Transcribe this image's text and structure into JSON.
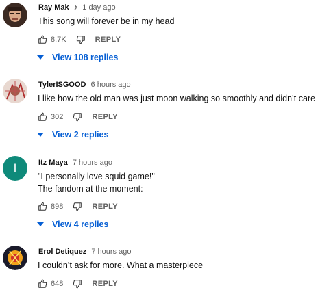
{
  "comments": [
    {
      "author": "Ray Mak",
      "note_icon": "music-note-icon",
      "time": "1 day ago",
      "lines": [
        "This song will forever be in my head"
      ],
      "likes": "8.7K",
      "reply_label": "REPLY",
      "view_replies": "View 108 replies",
      "avatar_color": "#6b4a3a"
    },
    {
      "author": "TylerISGOOD",
      "time": "6 hours ago",
      "lines": [
        "I like how the old man was just moon walking so smoothly and didn’t care"
      ],
      "likes": "302",
      "reply_label": "REPLY",
      "view_replies": "View 2 replies",
      "avatar_color": "#c87a7a"
    },
    {
      "author": "Itz Maya",
      "time": "7 hours ago",
      "avatar_letter": "I",
      "lines": [
        "\"I personally love squid game!\"",
        "The fandom at the moment:"
      ],
      "likes": "898",
      "reply_label": "REPLY",
      "view_replies": "View 4 replies",
      "avatar_color": "#0f8a7a"
    },
    {
      "author": "Erol Detiquez",
      "time": "7 hours ago",
      "lines": [
        "I couldn’t ask for more. What a masterpiece"
      ],
      "likes": "648",
      "reply_label": "REPLY",
      "avatar_color": "#f2a21b"
    }
  ],
  "colors": {
    "link": "#065fd4",
    "secondary": "#606060",
    "text": "#0f0f0f"
  }
}
